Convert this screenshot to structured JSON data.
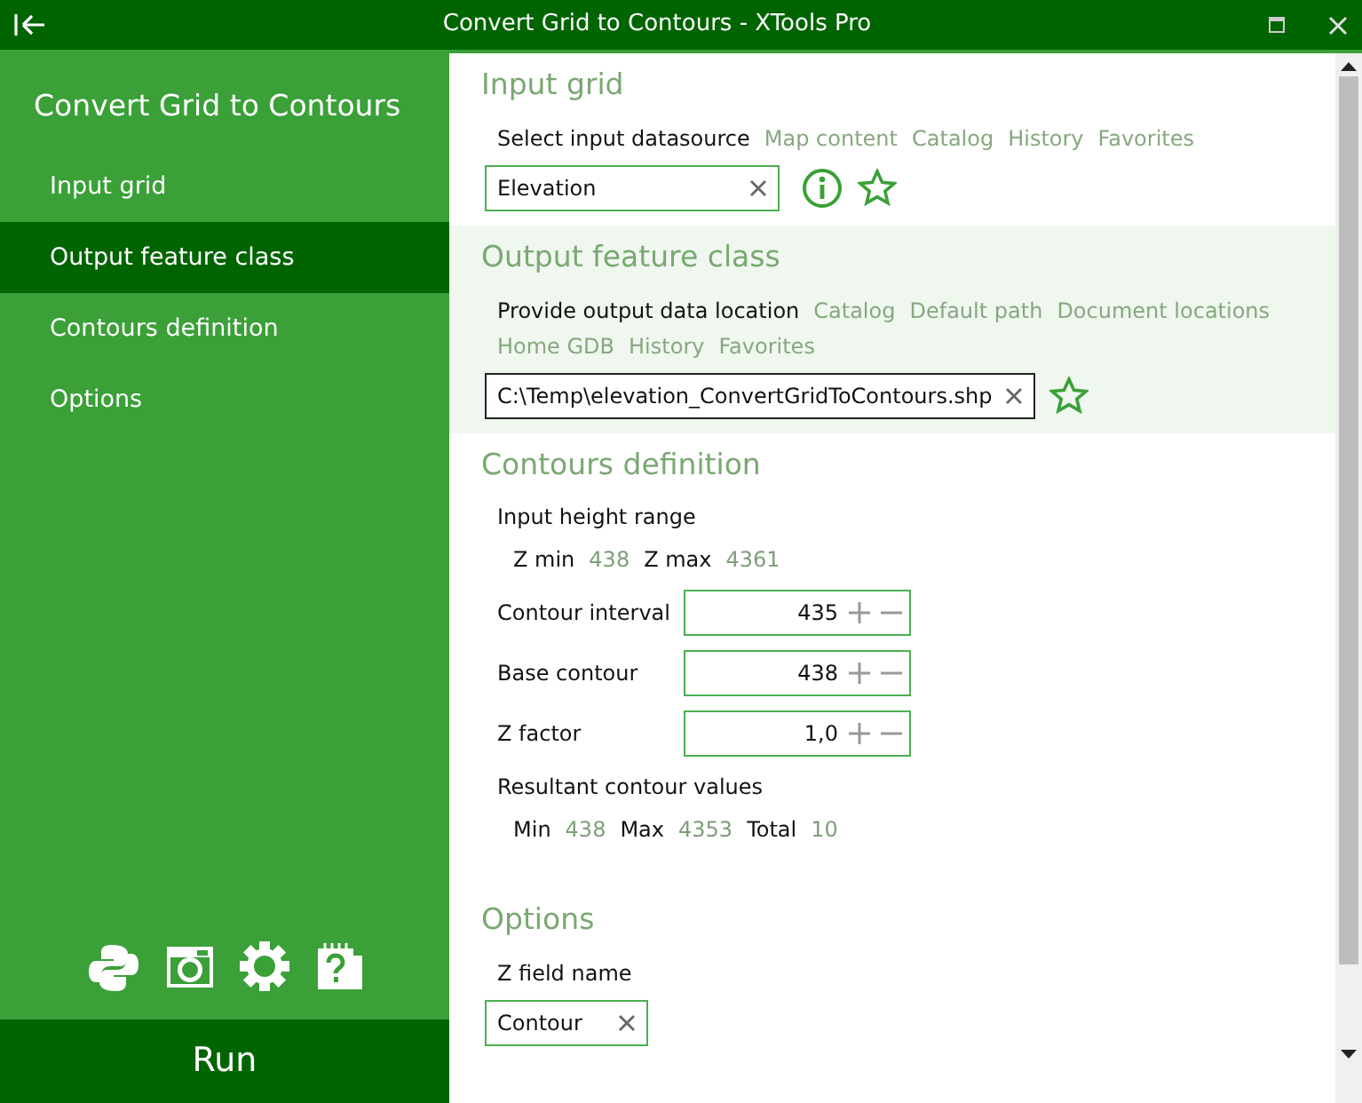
{
  "window": {
    "title": "Convert Grid to Contours - XTools Pro"
  },
  "sidebar": {
    "title": "Convert Grid to Contours",
    "items": [
      {
        "label": "Input grid",
        "selected": false
      },
      {
        "label": "Output feature class",
        "selected": true
      },
      {
        "label": "Contours definition",
        "selected": false
      },
      {
        "label": "Options",
        "selected": false
      }
    ],
    "run_button": "Run"
  },
  "input_grid": {
    "heading": "Input grid",
    "highlighted": false,
    "prompt": "Select input datasource",
    "links": [
      "Map content",
      "Catalog",
      "History",
      "Favorites"
    ],
    "value": "Elevation"
  },
  "output_feature_class": {
    "heading": "Output feature class",
    "highlighted": true,
    "prompt": "Provide output data location",
    "links": [
      "Catalog",
      "Default path",
      "Document locations",
      "Home GDB",
      "History",
      "Favorites"
    ],
    "value": "C:\\Temp\\elevation_ConvertGridToContours.shp"
  },
  "contours_definition": {
    "heading": "Contours definition",
    "range_label": "Input height range",
    "range": [
      {
        "label": "Z min",
        "value": "438"
      },
      {
        "label": "Z max",
        "value": "4361"
      }
    ],
    "spinners": [
      {
        "label": "Contour interval",
        "value": "435"
      },
      {
        "label": "Base contour",
        "value": "438"
      },
      {
        "label": "Z factor",
        "value": "1,0"
      }
    ],
    "result_label": "Resultant contour values",
    "results": [
      {
        "label": "Min",
        "value": "438"
      },
      {
        "label": "Max",
        "value": "4353"
      },
      {
        "label": "Total",
        "value": "10"
      }
    ]
  },
  "options": {
    "heading": "Options",
    "field_label": "Z field name",
    "value": "Contour"
  }
}
